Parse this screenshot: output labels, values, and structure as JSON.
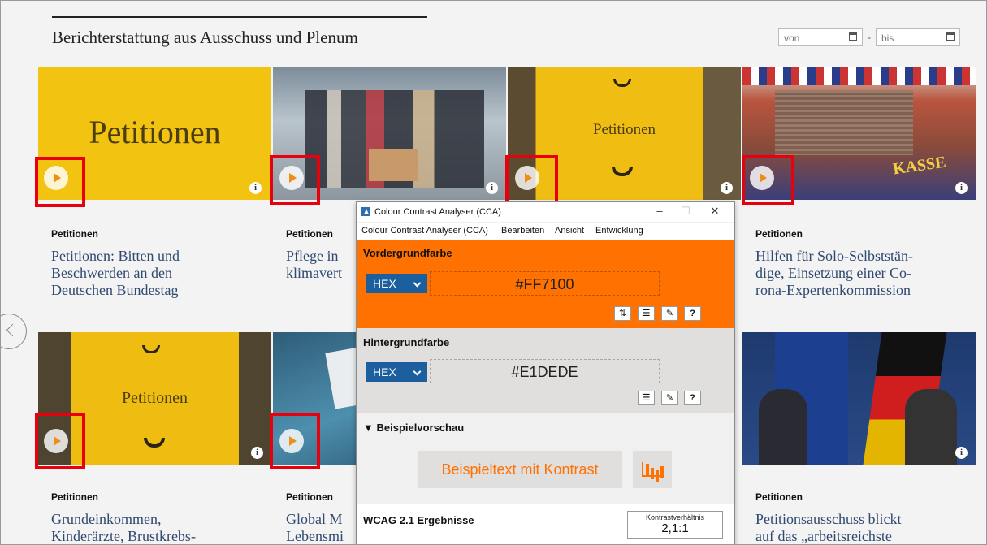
{
  "header": {
    "title": "Berichterstattung aus Ausschuss und Plenum",
    "date_from_placeholder": "von",
    "date_to_placeholder": "bis",
    "date_separator": "-"
  },
  "cards": [
    {
      "category": "Petitionen",
      "title_lines": [
        "Petitionen: Bitten und",
        "Beschwerden an den",
        "Deutschen Bundestag"
      ],
      "image_text": "Petitionen"
    },
    {
      "category": "Petitionen",
      "title_lines": [
        "Pflege in",
        "klimavert"
      ]
    },
    {
      "category": "",
      "title_lines": [],
      "image_text": "Petitionen"
    },
    {
      "category": "Petitionen",
      "title_lines": [
        "Hilfen für Solo-Selbststän-",
        "dige, Einsetzung einer Co-",
        "rona-Expertenkommission"
      ],
      "image_text": "KASSE"
    },
    {
      "category": "Petitionen",
      "title_lines": [
        "Grundeinkommen,",
        "Kinderärzte, Brustkrebs-"
      ],
      "image_text": "Petitionen"
    },
    {
      "category": "Petitionen",
      "title_lines": [
        "Global M",
        "Lebensmi"
      ]
    },
    {
      "category": "Petitionen",
      "title_lines": [
        "Petitionsausschuss blickt",
        "auf das „arbeitsreichste"
      ]
    }
  ],
  "cca": {
    "title": "Colour Contrast Analyser (CCA)",
    "menu": [
      "Colour Contrast Analyser (CCA)",
      "Bearbeiten",
      "Ansicht",
      "Entwicklung"
    ],
    "foreground": {
      "label": "Vordergrundfarbe",
      "format": "HEX",
      "value": "#FF7100"
    },
    "background": {
      "label": "Hintergrundfarbe",
      "format": "HEX",
      "value": "#E1DEDE"
    },
    "preview": {
      "label": "▼ Beispielvorschau",
      "sample_text": "Beispieltext mit Kontrast"
    },
    "wcag": {
      "label": "WCAG 2.1 Ergebnisse",
      "ratio_label": "Kontrastverhältnis",
      "ratio_value": "2,1:1"
    },
    "colors": {
      "foreground": "#FF7100",
      "background": "#E1DEDE"
    }
  }
}
